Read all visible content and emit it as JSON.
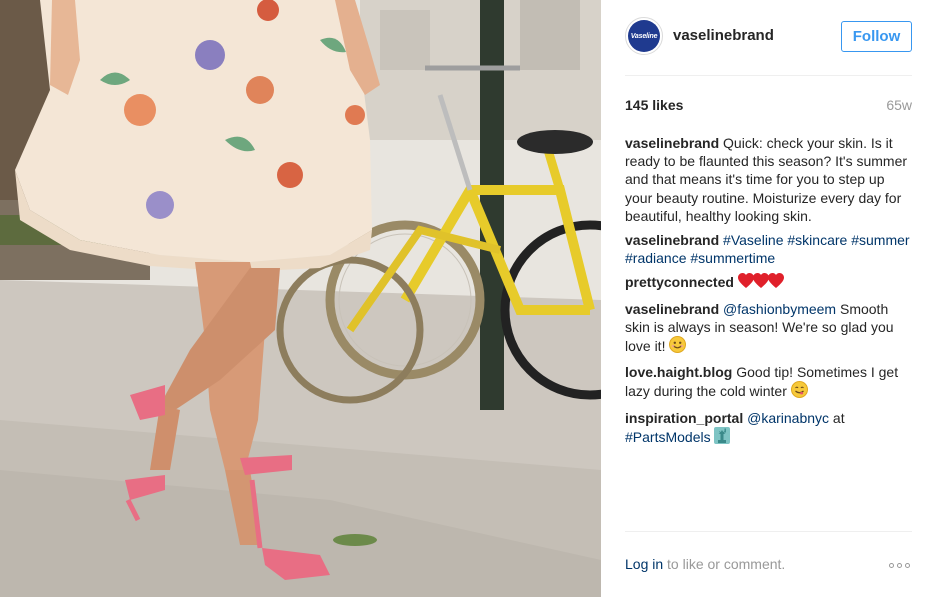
{
  "post": {
    "image_alt": "Woman in floral dress and pink sandals walking past yellow bicycles",
    "author": "vaselinebrand",
    "avatar_logo_text": "Vaseline",
    "follow_label": "Follow",
    "likes": "145 likes",
    "age": "65w"
  },
  "comments": [
    {
      "user": "vaselinebrand",
      "parts": [
        {
          "type": "text",
          "value": "Quick: check your skin. Is it ready to be flaunted this season? It's summer and that means it's time for you to step up your beauty routine. Moisturize every day for beautiful, healthy looking skin."
        }
      ]
    },
    {
      "user": "vaselinebrand",
      "parts": [
        {
          "type": "link",
          "value": "#Vaseline"
        },
        {
          "type": "text",
          "value": " "
        },
        {
          "type": "link",
          "value": "#skincare"
        },
        {
          "type": "text",
          "value": " "
        },
        {
          "type": "link",
          "value": "#summer"
        },
        {
          "type": "text",
          "value": " "
        },
        {
          "type": "link",
          "value": "#radiance"
        },
        {
          "type": "text",
          "value": " "
        },
        {
          "type": "link",
          "value": "#summertime"
        }
      ]
    },
    {
      "user": "prettyconnected",
      "parts": [
        {
          "type": "emoji",
          "value": "hearts",
          "icon": "three-red-hearts-icon"
        }
      ]
    },
    {
      "user": "vaselinebrand",
      "parts": [
        {
          "type": "link",
          "value": "@fashionbymeem"
        },
        {
          "type": "text",
          "value": " Smooth skin is always in season! We're so glad you love it! "
        },
        {
          "type": "emoji",
          "value": "smile",
          "icon": "smiling-face-icon"
        }
      ]
    },
    {
      "user": "love.haight.blog",
      "parts": [
        {
          "type": "text",
          "value": "Good tip! Sometimes I get lazy during the cold winter "
        },
        {
          "type": "emoji",
          "value": "yum",
          "icon": "yum-face-icon"
        }
      ]
    },
    {
      "user": "inspiration_portal",
      "parts": [
        {
          "type": "link",
          "value": "@karinabnyc"
        },
        {
          "type": "text",
          "value": " at "
        },
        {
          "type": "link",
          "value": "#PartsModels"
        },
        {
          "type": "text",
          "value": " "
        },
        {
          "type": "emoji",
          "value": "liberty",
          "icon": "statue-of-liberty-icon"
        }
      ]
    }
  ],
  "footer": {
    "login_link": "Log in",
    "login_rest": " to like or comment.",
    "more_icon": "more-options-icon"
  },
  "colors": {
    "link": "#003569",
    "follow": "#3897f0",
    "muted": "#999999",
    "text": "#262626"
  }
}
